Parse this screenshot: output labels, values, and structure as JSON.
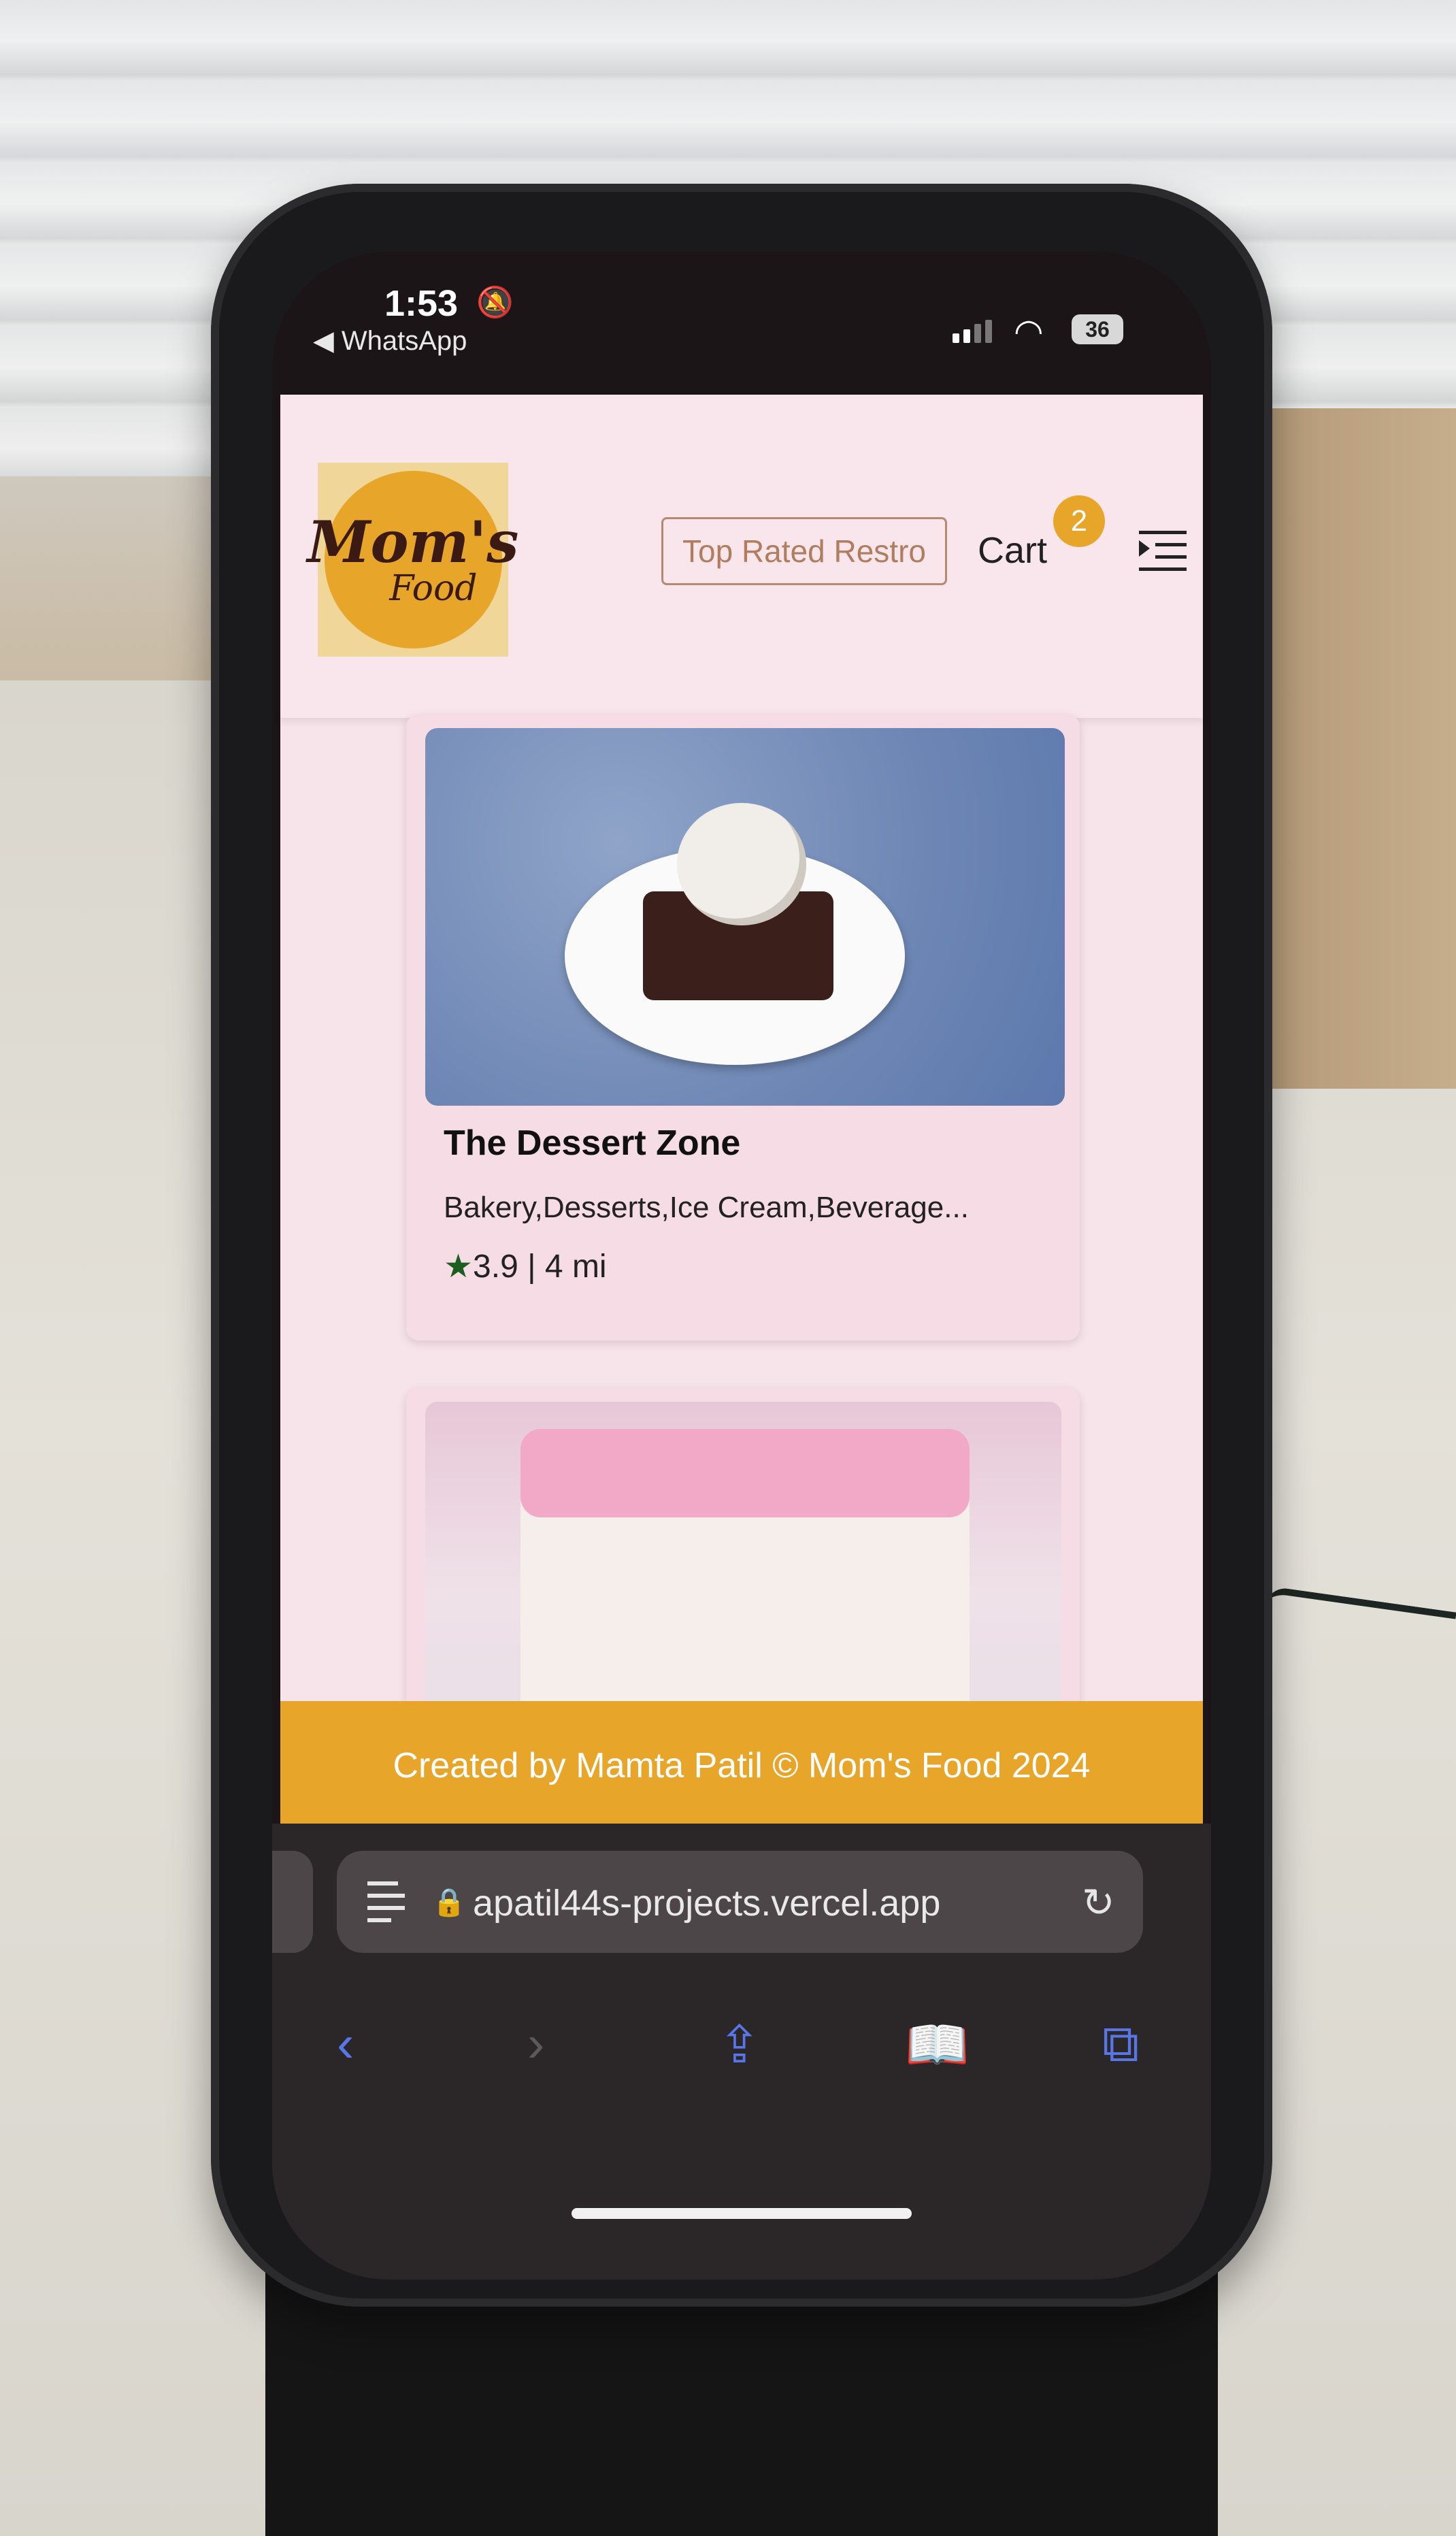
{
  "status_bar": {
    "time": "1:53",
    "back_app": "◀ WhatsApp",
    "battery": "36",
    "icons": [
      "bell-slash-icon",
      "signal-icon",
      "wifi-icon",
      "battery-icon"
    ]
  },
  "header": {
    "logo_line1": "Mom's",
    "logo_line2": "Food",
    "top_rated_label": "Top Rated Restro",
    "cart_label": "Cart",
    "cart_count": "2",
    "menu_icon": "menu-indent-icon"
  },
  "restaurants": [
    {
      "name": "The Dessert Zone",
      "cuisines": "Bakery,Desserts,Ice Cream,Beverage...",
      "rating": "3.9",
      "distance_text": "| 4 mi"
    },
    {
      "name": "",
      "cuisines": "",
      "rating": "",
      "distance_text": ""
    }
  ],
  "footer": {
    "text": "Created by Mamta Patil © Mom's Food 2024"
  },
  "browser": {
    "url": "apatil44s-projects.vercel.app",
    "toolbar": [
      "back-icon",
      "forward-icon",
      "share-icon",
      "bookmarks-icon",
      "tabs-icon"
    ]
  },
  "colors": {
    "accent": "#e7a52a",
    "page_bg": "#f7e3ea",
    "rating_star": "#1b5e20",
    "link_blue": "#5876e6"
  }
}
